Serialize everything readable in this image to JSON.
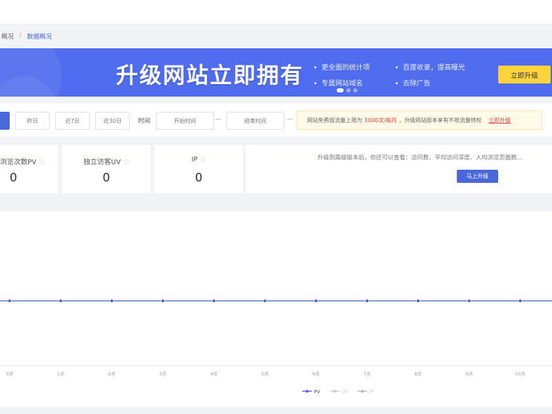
{
  "breadcrumb": {
    "item1": "概况",
    "item2": "数据概况",
    "separator": "/"
  },
  "banner": {
    "title": "升级网站立即拥有",
    "features": [
      "更全面的统计项",
      "百度收录，提高曝光",
      "专属网站域名",
      "去除广告"
    ],
    "cta": "立即升级"
  },
  "filters": {
    "active": "今日",
    "buttons": [
      "今日",
      "昨日",
      "近7日",
      "近30日"
    ],
    "time_label": "时间",
    "start_placeholder": "开始时间",
    "range_dash": "—",
    "end_placeholder": "结束时间",
    "notice_prefix": "网站免费版流量上限为",
    "notice_limit": "1000次/每月",
    "notice_suffix": "，升级网站版本享有不限流量特权",
    "notice_link": "立即升级"
  },
  "stats": [
    {
      "label": "浏览次数PV",
      "value": "0"
    },
    {
      "label": "独立访客UV",
      "value": "0"
    },
    {
      "label": "IP",
      "value": "0"
    }
  ],
  "promo": {
    "text": "升级到高级版本后，你还可以查看：访问数、平均访问深度、人均浏览页面数…",
    "button": "马上升级"
  },
  "colors": {
    "accent": "#4a68d8",
    "banner": "#4f6bee",
    "cta": "#ffd43b",
    "warning": "#e23c3c"
  },
  "chart_data": {
    "type": "line",
    "categories": [
      "0点",
      "1点",
      "2点",
      "3点",
      "4点",
      "5点",
      "6点",
      "7点",
      "8点",
      "9点",
      "10点"
    ],
    "series": [
      {
        "name": "PV",
        "values": [
          0,
          0,
          0,
          0,
          0,
          0,
          0,
          0,
          0,
          0,
          0
        ]
      },
      {
        "name": "UV",
        "values": [
          0,
          0,
          0,
          0,
          0,
          0,
          0,
          0,
          0,
          0,
          0
        ]
      },
      {
        "name": "IP",
        "values": [
          0,
          0,
          0,
          0,
          0,
          0,
          0,
          0,
          0,
          0,
          0
        ]
      }
    ],
    "legend": "bottom-center",
    "grid": false
  }
}
